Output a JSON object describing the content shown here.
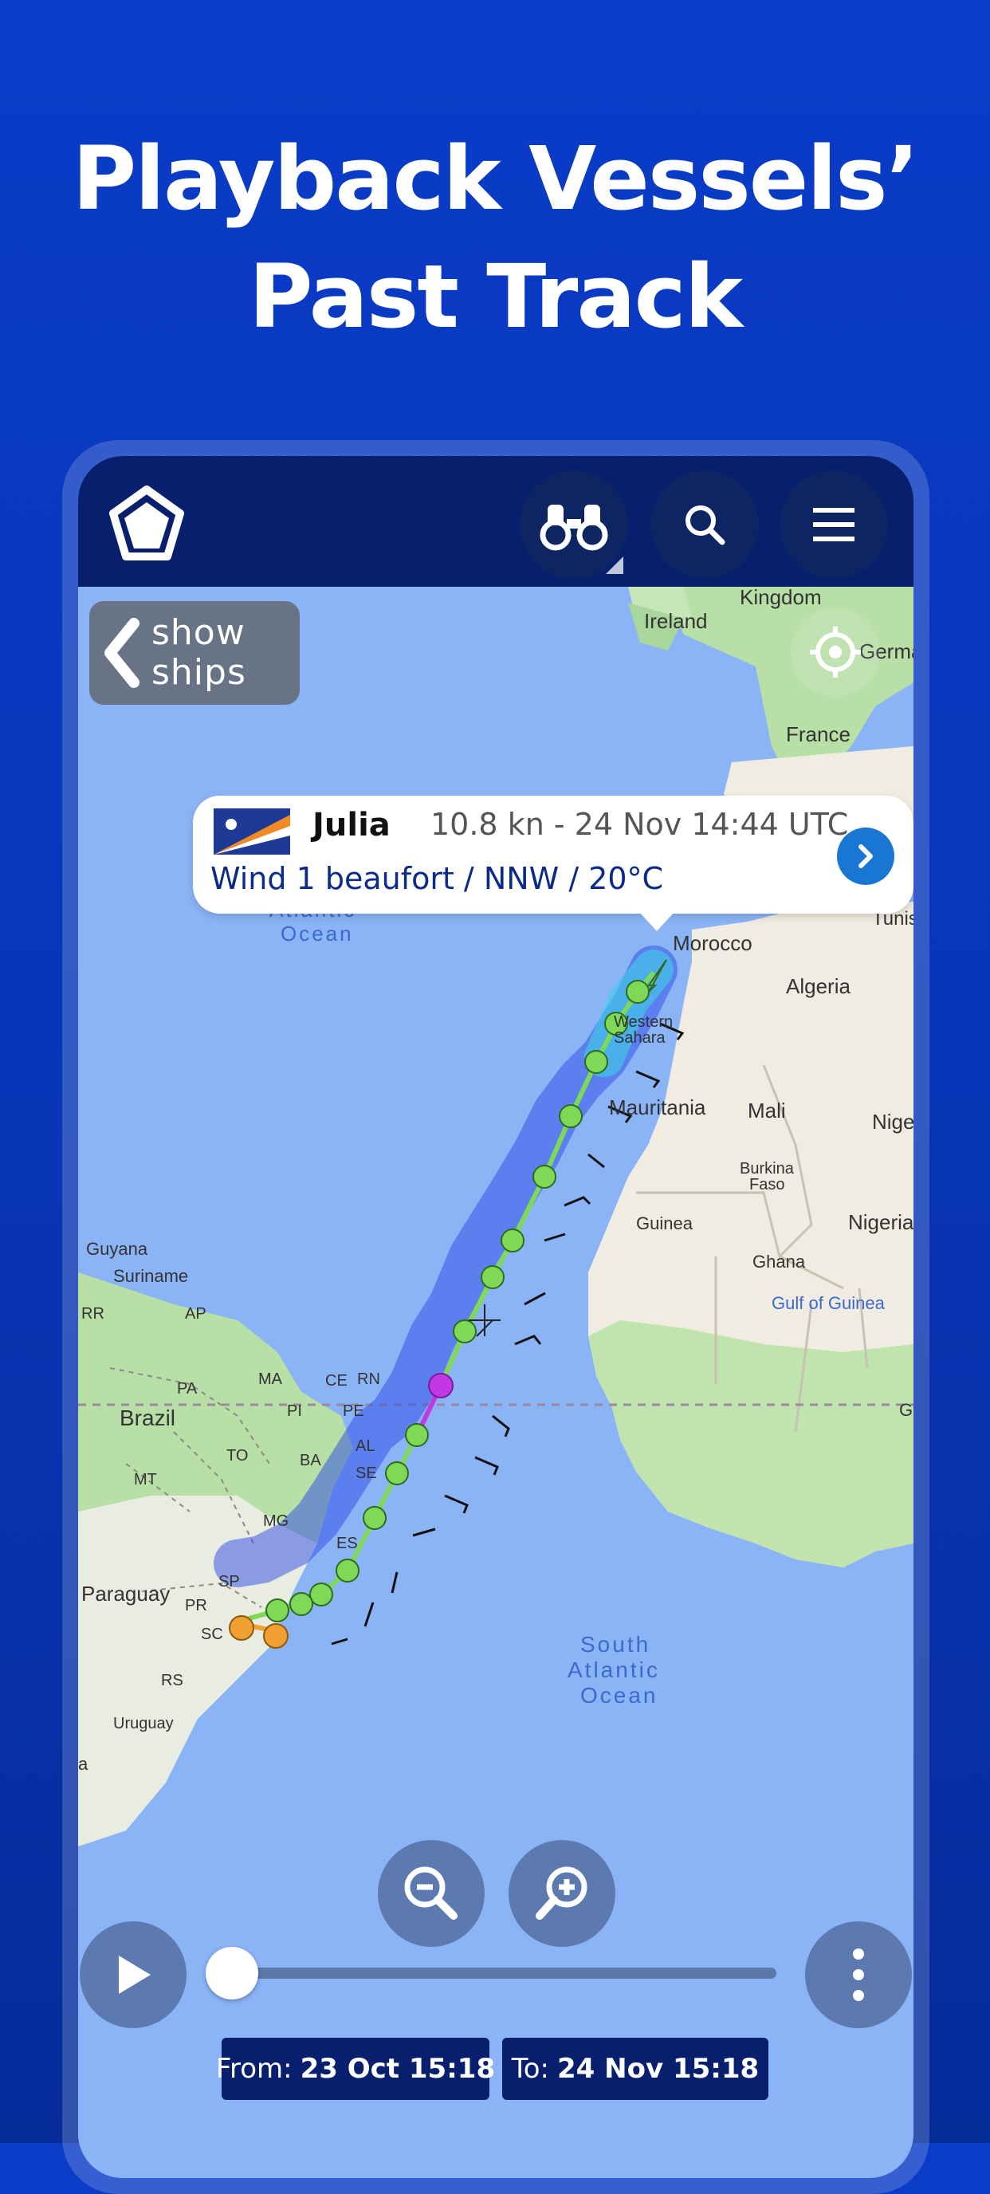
{
  "headline": {
    "line1": "Playback Vessels’",
    "line2": "Past Track"
  },
  "appbar": {
    "logo_icon": "pentagon-logo-icon",
    "binoculars_icon": "binoculars-icon",
    "search_icon": "search-icon",
    "menu_icon": "hamburger-menu-icon"
  },
  "map": {
    "show_ships": {
      "line1": "show",
      "line2": "ships"
    },
    "labels": {
      "kingdom": "Kingdom",
      "ireland": "Ireland",
      "germany": "Germa",
      "france": "France",
      "atlantic1": "Atlantic",
      "atlantic2": "Ocean",
      "morocco": "Morocco",
      "tunisia": "Tunis",
      "algeria": "Algeria",
      "western1": "Western",
      "western2": "Sahara",
      "mauritania": "Mauritania",
      "mali": "Mali",
      "niger": "Nige",
      "burkina1": "Burkina",
      "burkina2": "Faso",
      "guinea": "Guinea",
      "nigeria": "Nigeria",
      "ghana": "Ghana",
      "gulf": "Gulf of Guinea",
      "guyana": "Guyana",
      "suriname": "Suriname",
      "rr": "RR",
      "ap": "AP",
      "pa": "PA",
      "ma": "MA",
      "ce": "CE",
      "rn": "RN",
      "brazil": "Brazil",
      "pi": "PI",
      "to": "TO",
      "pe": "PE",
      "al": "AL",
      "mt": "MT",
      "ba": "BA",
      "se": "SE",
      "mg": "MG",
      "es": "ES",
      "paraguay": "Paraguay",
      "sp": "SP",
      "pr": "PR",
      "sc": "SC",
      "rs": "RS",
      "uruguay": "Uruguay",
      "g": "G",
      "a": "a",
      "south1": "South",
      "south2": "Atlantic",
      "south3": "Ocean"
    }
  },
  "popup": {
    "flag": "marshall-islands-flag",
    "vessel_name": "Julia",
    "status": "10.8 kn - 24 Nov 14:44 UTC",
    "weather": "Wind 1 beaufort / NNW / 20°C"
  },
  "controls": {
    "zoom_out_icon": "zoom-out-icon",
    "zoom_in_icon": "zoom-in-icon",
    "play_icon": "play-icon",
    "more_icon": "more-vertical-icon",
    "from_label": "From:",
    "from_value": "23 Oct 15:18",
    "to_label": "To:",
    "to_value": "24 Nov 15:18"
  },
  "colors": {
    "background": "#0a3cc8",
    "appbar": "#071f6c",
    "ocean": "#8bb4f7",
    "land": "#f0ece2",
    "vegetation": "#b7dfa6",
    "track_green": "#7ed957",
    "track_blue": "#2c49e6",
    "track_magenta": "#c238e6",
    "track_orange": "#f0a030",
    "accent_blue": "#1976d2"
  }
}
